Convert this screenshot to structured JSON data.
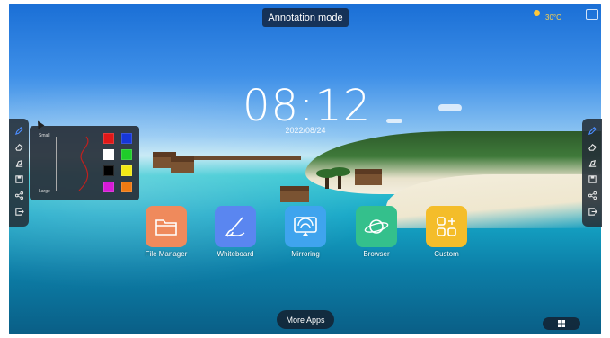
{
  "header": {
    "annotation_mode_label": "Annotation mode"
  },
  "weather": {
    "top_text": "",
    "temperature": "30°C"
  },
  "clock": {
    "time": "08:12",
    "date": "2022/08/24"
  },
  "pen_panel": {
    "size_small_label": "Small",
    "size_large_label": "Large",
    "colors": [
      "#e01818",
      "#1637d8",
      "#ffffff",
      "#1fcc2a",
      "#000000",
      "#f2e915",
      "#d61ad6",
      "#f07a12"
    ]
  },
  "left_toolbar": {
    "tools": [
      {
        "icon": "pen-icon",
        "active": true
      },
      {
        "icon": "eraser-icon",
        "active": false
      },
      {
        "icon": "clear-icon",
        "active": false
      },
      {
        "icon": "save-icon",
        "active": false
      },
      {
        "icon": "share-icon",
        "active": false
      },
      {
        "icon": "exit-icon",
        "active": false
      }
    ]
  },
  "right_toolbar": {
    "tools": [
      {
        "icon": "pen-icon",
        "active": true
      },
      {
        "icon": "eraser-icon",
        "active": false
      },
      {
        "icon": "clear-icon",
        "active": false
      },
      {
        "icon": "save-icon",
        "active": false
      },
      {
        "icon": "share-icon",
        "active": false
      },
      {
        "icon": "exit-icon",
        "active": false
      }
    ]
  },
  "apps": [
    {
      "label": "File Manager",
      "icon": "folder-icon",
      "color": "#ef8a5c"
    },
    {
      "label": "Whiteboard",
      "icon": "brush-icon",
      "color": "#5a86f0"
    },
    {
      "label": "Mirroring",
      "icon": "cast-icon",
      "color": "#3fa4ee"
    },
    {
      "label": "Browser",
      "icon": "planet-icon",
      "color": "#34c08c"
    },
    {
      "label": "Custom",
      "icon": "grid-plus-icon",
      "color": "#f4bd2a"
    }
  ],
  "footer": {
    "more_apps_label": "More Apps",
    "windows_icon": "windows-icon"
  }
}
